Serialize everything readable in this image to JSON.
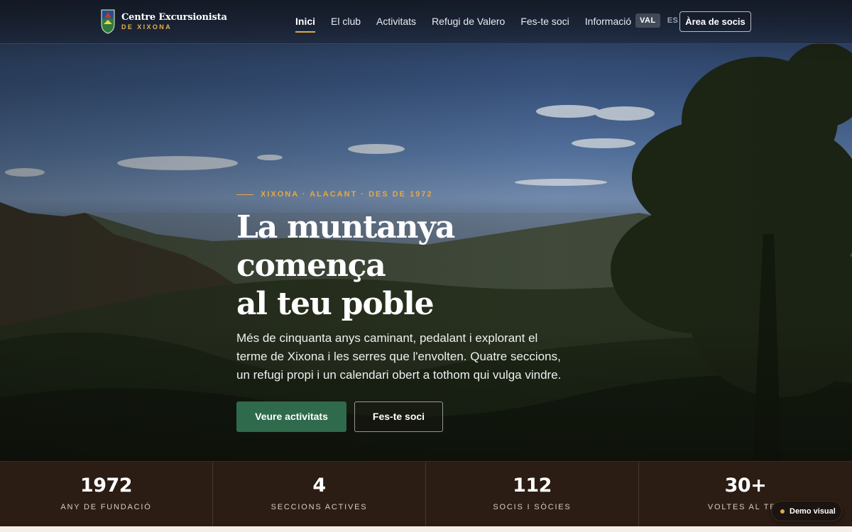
{
  "brand": {
    "name": "Centre Excursionista",
    "subtitle": "DE XIXONA"
  },
  "nav": {
    "items": [
      {
        "label": "Inici",
        "active": true
      },
      {
        "label": "El club"
      },
      {
        "label": "Activitats"
      },
      {
        "label": "Refugi de Valero"
      },
      {
        "label": "Fes-te soci"
      },
      {
        "label": "Informació"
      }
    ]
  },
  "lang": {
    "selected": "VAL",
    "other": "ES"
  },
  "header": {
    "members_button": "Àrea de socis"
  },
  "hero": {
    "eyebrow": "XIXONA · ALACANT · DES DE 1972",
    "title_line1": "La muntanya comença",
    "title_line2": "al teu poble",
    "lead": "Més de cinquanta anys caminant, pedalant i explorant el terme de Xixona i les serres que l'envolten. Quatre seccions, un refugi propi i un calendari obert a tothom qui vulga vindre.",
    "primary_button": "Veure activitats",
    "secondary_button": "Fes-te soci"
  },
  "stats": [
    {
      "value": "1972",
      "label": "ANY DE FUNDACIÓ"
    },
    {
      "value": "4",
      "label": "SECCIONS ACTIVES"
    },
    {
      "value": "112",
      "label": "SOCIS I SÒCIES"
    },
    {
      "value": "30+",
      "label": "VOLTES AL TER"
    }
  ],
  "demo_badge": {
    "label": "Demo visual"
  },
  "colors": {
    "accent": "#e2a948",
    "primary_button": "#2f6a4c",
    "stats_bg": "#2b1c14"
  }
}
